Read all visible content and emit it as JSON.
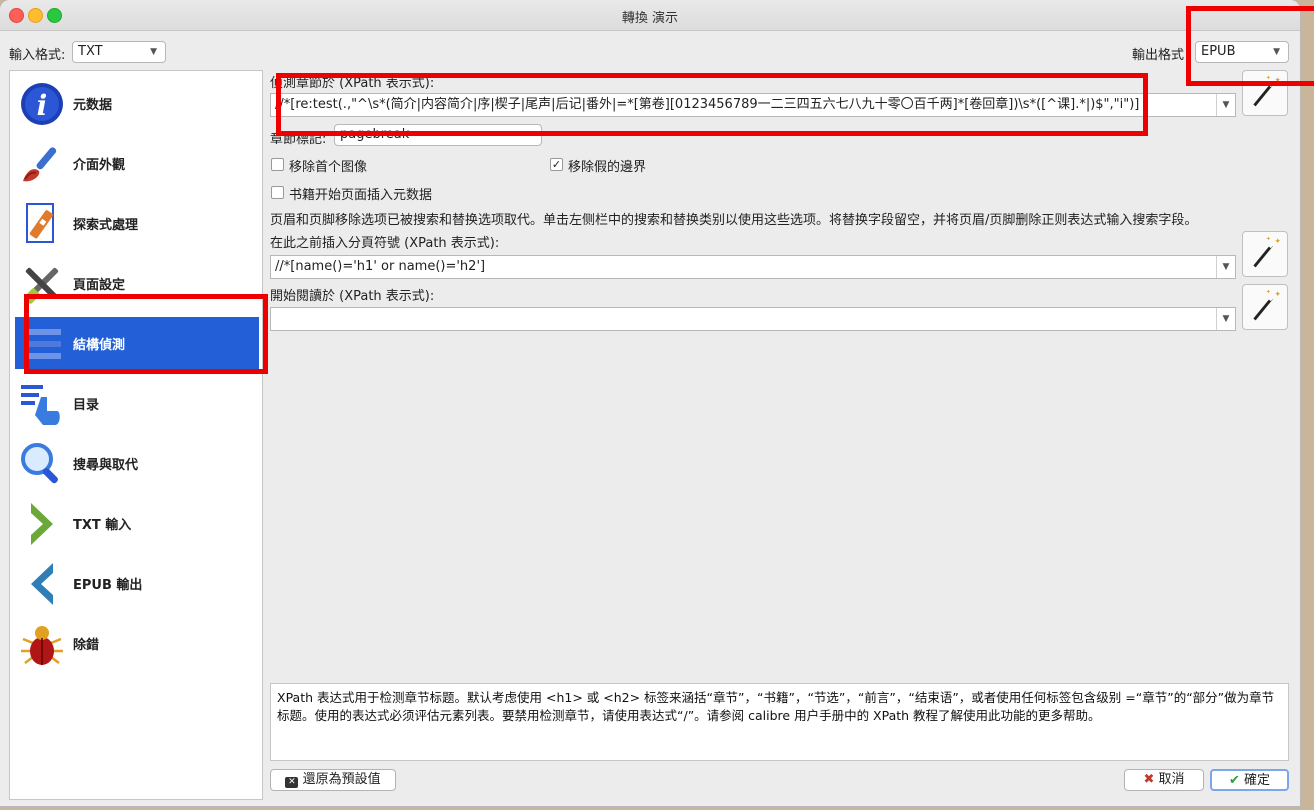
{
  "window": {
    "title": "轉換 演示"
  },
  "input_format": {
    "label": "輸入格式:",
    "value": "TXT"
  },
  "output_format": {
    "label": "輸出格式",
    "value": "EPUB"
  },
  "sidebar": {
    "items": [
      {
        "label": "元数据",
        "icon": "info-icon"
      },
      {
        "label": "介面外觀",
        "icon": "paintbrush-icon"
      },
      {
        "label": "探索式處理",
        "icon": "document-edit-icon"
      },
      {
        "label": "頁面設定",
        "icon": "tools-icon"
      },
      {
        "label": "結構偵測",
        "icon": "structure-list-icon",
        "active": true
      },
      {
        "label": "目录",
        "icon": "toc-pointer-icon"
      },
      {
        "label": "搜尋與取代",
        "icon": "magnifier-icon"
      },
      {
        "label": "TXT 輸入",
        "icon": "chevron-right-icon"
      },
      {
        "label": "EPUB 輸出",
        "icon": "chevron-left-icon"
      },
      {
        "label": "除錯",
        "icon": "bug-icon"
      }
    ]
  },
  "detect_chapters": {
    "label": "偵測章節於 (XPath 表示式):",
    "value": "//*[re:test(.,\"^\\s*(简介|内容简介|序|楔子|尾声|后记|番外|=*[第卷][0123456789一二三四五六七八九十零〇百千两]*[卷回章])\\s*([^课].*|)$\",\"i\")]"
  },
  "chapter_mark": {
    "label": "章節標記:",
    "value": "pagebreak"
  },
  "options": {
    "remove_first_image": {
      "label": "移除首个图像",
      "checked": false
    },
    "remove_fake_margins": {
      "label": "移除假的邊界",
      "checked": true,
      "mark": "✓"
    },
    "insert_metadata": {
      "label": "书籍开始页面插入元数据",
      "checked": false
    }
  },
  "header_footer_note": "页眉和页脚移除选项已被搜索和替换选项取代。单击左侧栏中的搜索和替换类别以使用这些选项。将替换字段留空，并将页眉/页脚删除正则表达式输入搜索字段。",
  "page_breaks": {
    "label": "在此之前插入分頁符號 (XPath 表示式):",
    "value": "//*[name()='h1' or name()='h2']"
  },
  "start_reading": {
    "label": "開始閱讀於 (XPath 表示式):",
    "value": ""
  },
  "help_text": "XPath 表达式用于检测章节标题。默认考虑使用 <h1> 或 <h2> 标签来涵括“章节”，“书籍”，“节选”，“前言”，“结束语”，或者使用任何标签包含级别 =“章节”的“部分”做为章节标题。使用的表达式必须评估元素列表。要禁用检测章节，请使用表达式“/”。请参阅 calibre 用户手册中的 XPath 教程了解使用此功能的更多帮助。",
  "buttons": {
    "restore": "還原為預設值",
    "cancel": "取消",
    "ok": "確定"
  },
  "colors": {
    "accent": "#2360d8",
    "annotation": "#ee0000"
  }
}
